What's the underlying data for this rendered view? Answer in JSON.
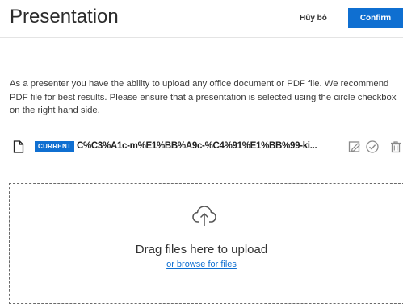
{
  "header": {
    "title": "Presentation",
    "cancel_label": "Hủy bỏ",
    "confirm_label": "Confirm"
  },
  "description": "As a presenter you have the ability to upload any office document or PDF file. We recommend PDF file for best results. Please ensure that a presentation is selected using the circle checkbox on the right hand side.",
  "file": {
    "badge": "CURRENT",
    "name": "C%C3%A1c-m%E1%BB%A9c-%C4%91%E1%BB%99-ki...",
    "icons": [
      "document-icon",
      "edit-icon",
      "check-circle-icon",
      "trash-icon"
    ]
  },
  "dropzone": {
    "icon": "cloud-upload-icon",
    "drag_text": "Drag files here to upload",
    "browse_text": "or browse for files"
  },
  "colors": {
    "accent": "#0f6fd1",
    "icon_gray": "#8a8a8a"
  }
}
